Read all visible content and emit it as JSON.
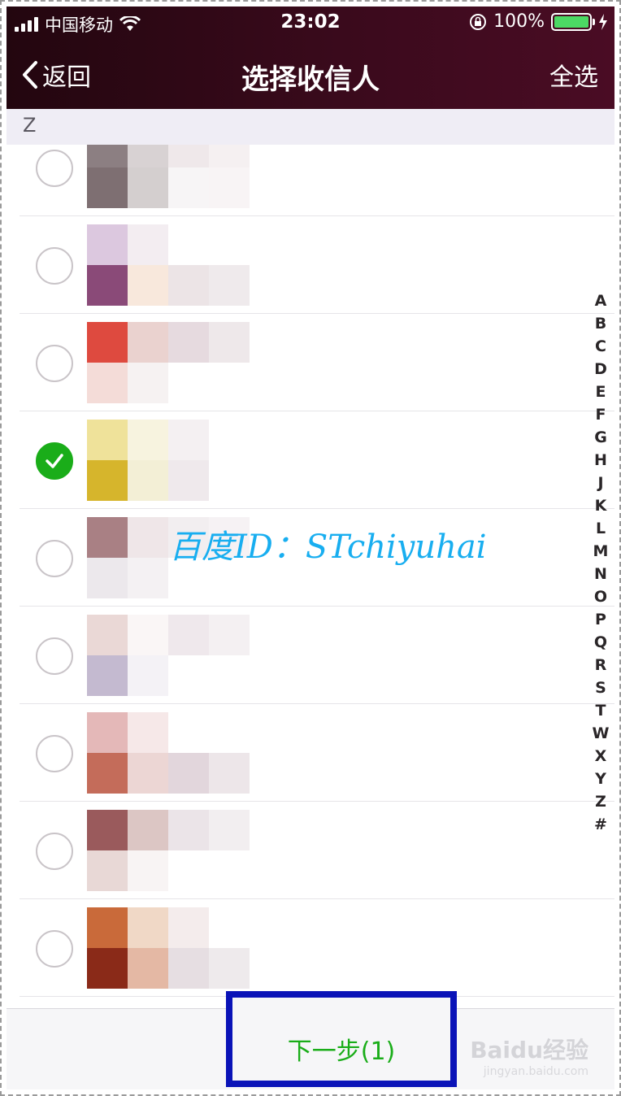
{
  "status_bar": {
    "carrier": "中国移动",
    "time": "23:02",
    "battery": "100%",
    "battery_level": 1.0
  },
  "nav": {
    "back_label": "返回",
    "title": "选择收信人",
    "select_all_label": "全选"
  },
  "section_header": "Z",
  "contacts": [
    {
      "checked": false,
      "tiles": [
        [
          "#8c7f82",
          "#d8d2d3",
          "#efe8ea",
          "#f5f0f1"
        ],
        [
          "#7e6f72",
          "#d4cfcf",
          "#f7f5f6",
          "#f8f4f5"
        ]
      ]
    },
    {
      "checked": false,
      "tiles": [
        [
          "#dcc8df",
          "#f3edf1",
          "#ffffff",
          "#ffffff"
        ],
        [
          "#8a4a78",
          "#f8e8dc",
          "#ece4e6",
          "#efeaec"
        ]
      ]
    },
    {
      "checked": false,
      "tiles": [
        [
          "#de4a3f",
          "#ead2cf",
          "#e6dadf",
          "#eee8ea"
        ],
        [
          "#f4dcd8",
          "#f6f2f2",
          "#ffffff",
          "#ffffff"
        ]
      ]
    },
    {
      "checked": true,
      "tiles": [
        [
          "#efe29a",
          "#f7f3df",
          "#f4f0f2",
          "#ffffff"
        ],
        [
          "#d6b52c",
          "#f3efd6",
          "#efe9ec",
          "#ffffff"
        ]
      ]
    },
    {
      "checked": false,
      "tiles": [
        [
          "#a98084",
          "#efe6e8",
          "#f2eef0",
          "#f6f2f4"
        ],
        [
          "#ece8ec",
          "#f4f1f3",
          "#ffffff",
          "#ffffff"
        ]
      ]
    },
    {
      "checked": false,
      "tiles": [
        [
          "#ead8d6",
          "#faf6f6",
          "#efe8ec",
          "#f4f0f2"
        ],
        [
          "#c4bad0",
          "#f4f2f6",
          "#ffffff",
          "#ffffff"
        ]
      ]
    },
    {
      "checked": false,
      "tiles": [
        [
          "#e4b8b8",
          "#f6e8e8",
          "#ffffff",
          "#ffffff"
        ],
        [
          "#c46c5a",
          "#ecd6d4",
          "#e2d6dc",
          "#ede6e9"
        ]
      ]
    },
    {
      "checked": false,
      "tiles": [
        [
          "#9a5a5c",
          "#dcc6c4",
          "#ebe4e8",
          "#f2eef0"
        ],
        [
          "#e8d8d6",
          "#f8f4f4",
          "#ffffff",
          "#ffffff"
        ]
      ]
    },
    {
      "checked": false,
      "tiles": [
        [
          "#c96a3a",
          "#f0d8c6",
          "#f4ecec",
          "#ffffff"
        ],
        [
          "#8a2a18",
          "#e4b8a4",
          "#e6dee2",
          "#eeeaec"
        ]
      ]
    }
  ],
  "index_letters": [
    "A",
    "B",
    "C",
    "D",
    "E",
    "F",
    "G",
    "H",
    "J",
    "K",
    "L",
    "M",
    "N",
    "O",
    "P",
    "Q",
    "R",
    "S",
    "T",
    "W",
    "X",
    "Y",
    "Z",
    "#"
  ],
  "watermark": "百度ID：STchiyuhai",
  "next_button_label": "下一步(1)",
  "baidu_logo": {
    "text": "Baidu经验",
    "subtext": "jingyan.baidu.com"
  },
  "colors": {
    "accent_green": "#1aad19",
    "highlight_box": "#0a13b8",
    "watermark": "#18aef0"
  }
}
